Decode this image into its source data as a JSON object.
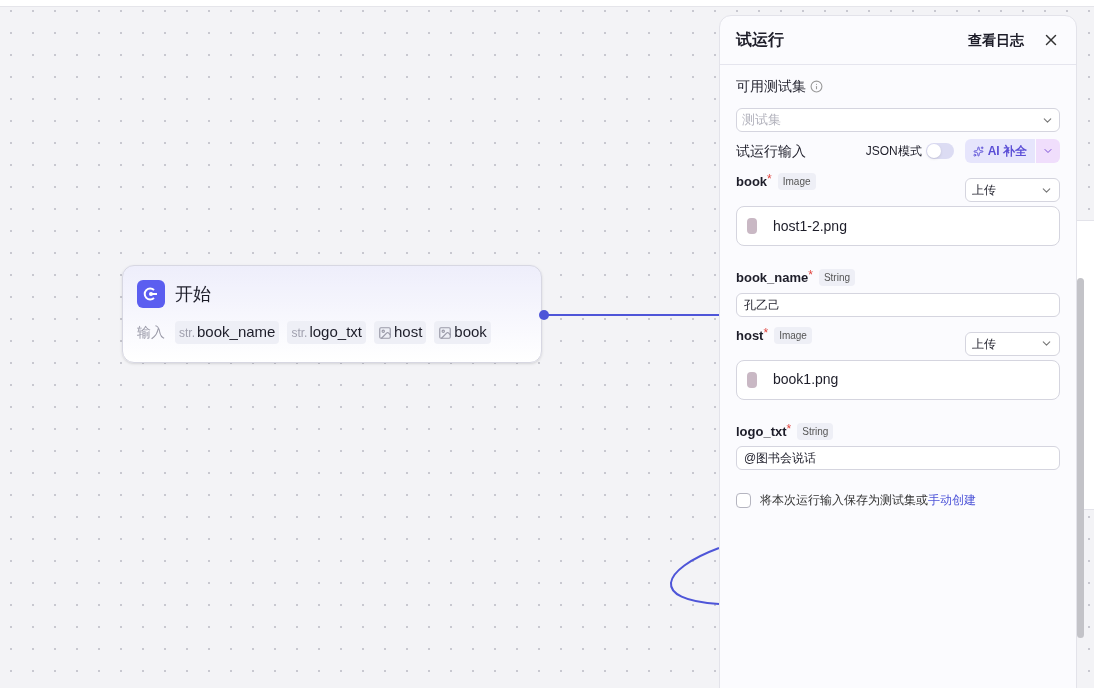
{
  "start_node": {
    "title": "开始",
    "inputs_label": "输入",
    "inputs": [
      {
        "kind": "str",
        "prefix": "str.",
        "name": "book_name"
      },
      {
        "kind": "str",
        "prefix": "str.",
        "name": "logo_txt"
      },
      {
        "kind": "image",
        "name": "host"
      },
      {
        "kind": "image",
        "name": "book"
      }
    ]
  },
  "panel": {
    "title": "试运行",
    "log_link": "查看日志",
    "testset_label": "可用测试集",
    "testset_placeholder": "测试集",
    "run_input_label": "试运行输入",
    "json_mode_label": "JSON模式",
    "json_mode_on": false,
    "ai_button": "AI 补全",
    "fields": [
      {
        "kind": "image",
        "name": "book",
        "type": "Image",
        "required": "*",
        "mode": "上传",
        "file": "host1-2.png"
      },
      {
        "kind": "string",
        "name": "book_name",
        "type": "String",
        "required": "*",
        "value": "孔乙己"
      },
      {
        "kind": "image",
        "name": "host",
        "type": "Image",
        "required": "*",
        "mode": "上传",
        "file": "book1.png"
      },
      {
        "kind": "string",
        "name": "logo_txt",
        "type": "String",
        "required": "*",
        "value": "@图书会说话"
      }
    ],
    "save_checked": false,
    "save_text": "将本次运行输入保存为测试集或",
    "save_link": "手动创建"
  }
}
